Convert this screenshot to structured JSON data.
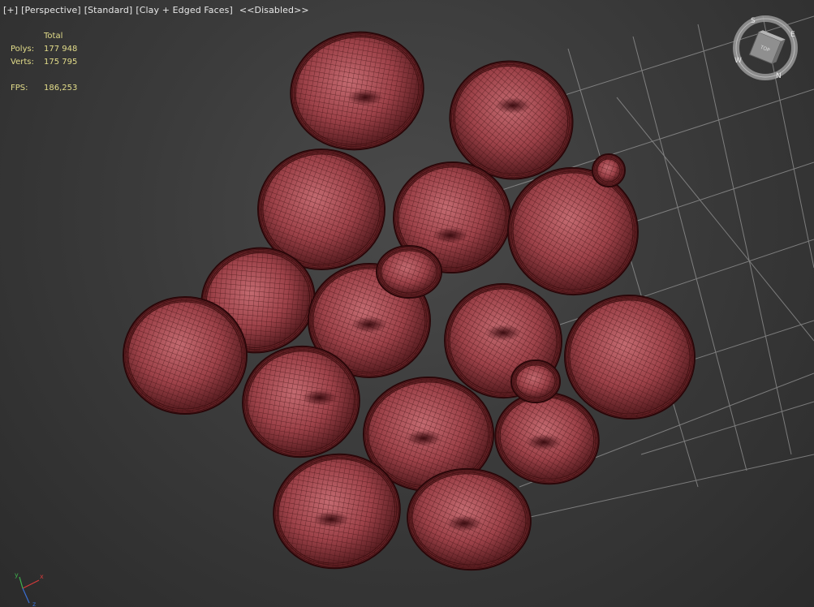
{
  "viewport": {
    "labels": [
      "[+]",
      "[Perspective]",
      "[Standard]",
      "[Clay + Edged Faces]"
    ],
    "disabled_label": "<<Disabled>>"
  },
  "stats": {
    "header": "Total",
    "polys_label": "Polys:",
    "polys_value": "177 948",
    "verts_label": "Verts:",
    "verts_value": "175 795",
    "fps_label": "FPS:",
    "fps_value": "186,253"
  },
  "viewcube": {
    "top_face_label": "TOP",
    "compass": [
      "S",
      "E",
      "N",
      "W"
    ]
  },
  "gizmo": {
    "axes": [
      "x",
      "y",
      "z"
    ],
    "axis_colors": [
      "#d33a3a",
      "#3fb34f",
      "#3a6fd3"
    ]
  },
  "scene": {
    "object_count": 18,
    "mesh_fill": "#a44b50",
    "wire_color": "#3c0f10",
    "grid_color": "#b8b8b8"
  }
}
